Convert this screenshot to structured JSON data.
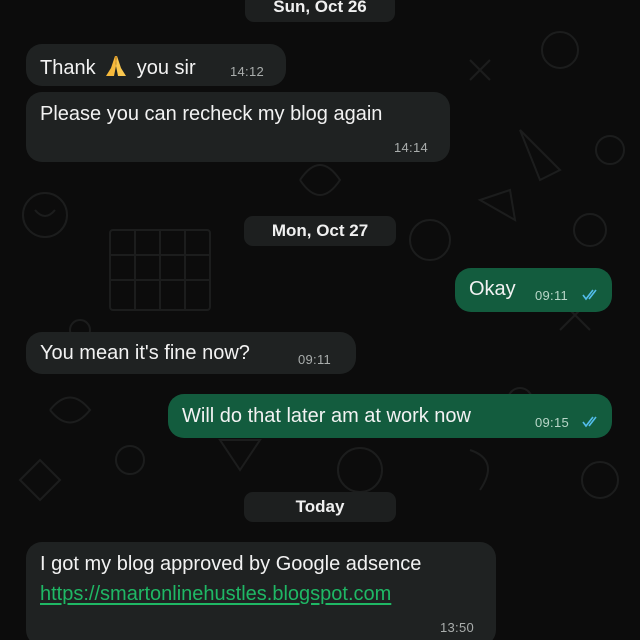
{
  "dates": {
    "oct26": "Sun, Oct 26",
    "oct27": "Mon, Oct 27",
    "today": "Today"
  },
  "messages": [
    {
      "direction": "in",
      "text_before": "Thank",
      "emoji": "folded-hands",
      "text_after": "you sir",
      "time": "14:12"
    },
    {
      "direction": "in",
      "text": "Please you can recheck my blog again",
      "time": "14:14"
    },
    {
      "direction": "out",
      "text": "Okay",
      "time": "09:11",
      "status": "read"
    },
    {
      "direction": "in",
      "text": "You mean it's fine now?",
      "time": "09:11"
    },
    {
      "direction": "out",
      "text": "Will do that later am at work now",
      "time": "09:15",
      "status": "read"
    },
    {
      "direction": "in",
      "text": "I got my blog approved by Google adsence",
      "link": "https://smartonlinehustles.blogspot.com",
      "time": "13:50"
    }
  ],
  "colors": {
    "incoming_bubble": "#1f2222",
    "outgoing_bubble": "#135c3e",
    "read_ticks": "#53bdeb",
    "link": "#1fb865"
  }
}
